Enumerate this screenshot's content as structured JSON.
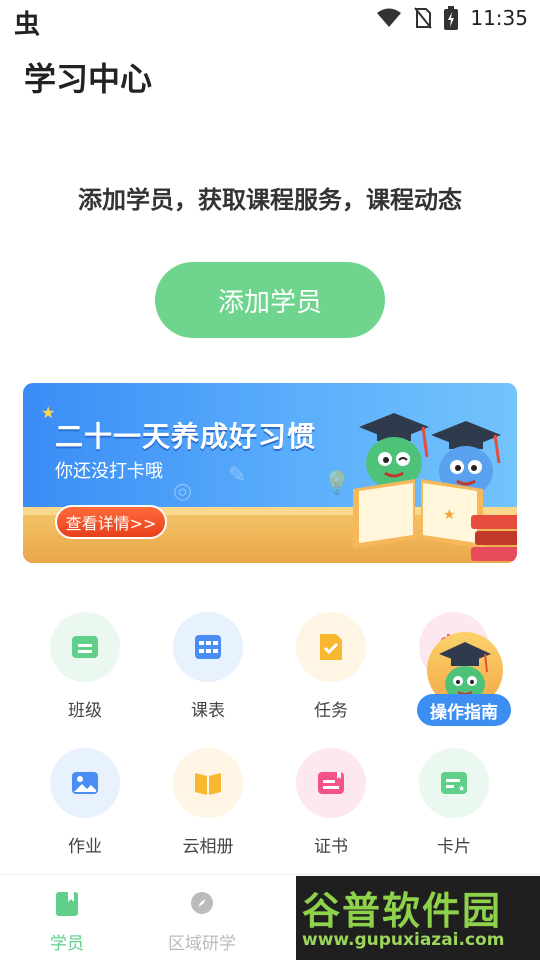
{
  "status_bar": {
    "app_glyph": "虫",
    "time": "11:35",
    "icons": [
      "wifi-icon",
      "no-sim-icon",
      "battery-charging-icon"
    ]
  },
  "page": {
    "title": "学习中心",
    "prompt": "添加学员，获取课程服务，课程动态",
    "add_button": "添加学员"
  },
  "banner": {
    "title": "二十一天养成好习惯",
    "subtitle": "你还没打卡哦",
    "button": "查看详情>>"
  },
  "grid": [
    {
      "label": "班级",
      "icon": "class-icon",
      "color": "#5fcf8a",
      "bg": "#eaf8ef"
    },
    {
      "label": "课表",
      "icon": "timetable-icon",
      "color": "#4a8ef5",
      "bg": "#e8f1fe"
    },
    {
      "label": "任务",
      "icon": "task-icon",
      "color": "#f7b731",
      "bg": "#fef5e4"
    },
    {
      "label": "",
      "icon": "calendar-icon",
      "color": "#f2548a",
      "bg": "#fde8ef"
    },
    {
      "label": "作业",
      "icon": "homework-icon",
      "color": "#4a8ef5",
      "bg": "#e8f1fe"
    },
    {
      "label": "云相册",
      "icon": "cloud-album-icon",
      "color": "#f7b731",
      "bg": "#fef5e4"
    },
    {
      "label": "证书",
      "icon": "certificate-icon",
      "color": "#f2548a",
      "bg": "#fde8ef"
    },
    {
      "label": "卡片",
      "icon": "card-icon",
      "color": "#5fcf8a",
      "bg": "#eaf8ef"
    }
  ],
  "guide": {
    "label": "操作指南"
  },
  "bottom_nav": [
    {
      "label": "学员",
      "icon": "student-book-icon",
      "active": true,
      "color": "#5fcf8a"
    },
    {
      "label": "区域研学",
      "icon": "compass-icon",
      "active": false,
      "color": "#bbbbbb"
    }
  ],
  "watermark": {
    "logo": "谷普软件园",
    "url": "www.gupuxiazai.com"
  }
}
